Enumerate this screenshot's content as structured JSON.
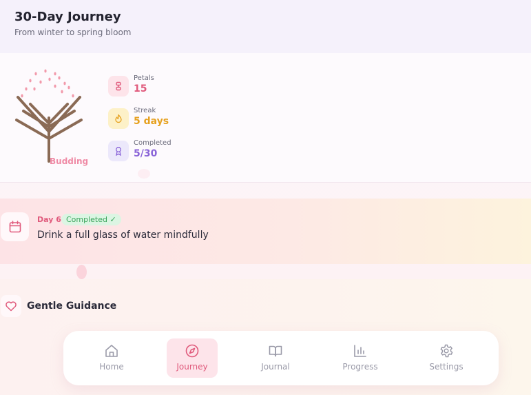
{
  "header": {
    "title": "30-Day Journey",
    "subtitle": "From winter to spring bloom"
  },
  "tree": {
    "stage": "Budding"
  },
  "stats": [
    {
      "label": "Petals",
      "value": "15",
      "icon": "flower-icon"
    },
    {
      "label": "Streak",
      "value": "5 days",
      "icon": "flame-icon"
    },
    {
      "label": "Completed",
      "value": "5/30",
      "icon": "award-icon"
    }
  ],
  "today": {
    "day": "Day 6",
    "status": "Completed ✓",
    "task": "Drink a full glass of water mindfully",
    "icon": "calendar-icon"
  },
  "guidance": {
    "title": "Gentle Guidance",
    "icon": "heart-icon"
  },
  "nav": {
    "items": [
      {
        "label": "Home",
        "icon": "home-icon"
      },
      {
        "label": "Journey",
        "icon": "compass-icon",
        "active": true
      },
      {
        "label": "Journal",
        "icon": "book-icon"
      },
      {
        "label": "Progress",
        "icon": "chart-icon"
      },
      {
        "label": "Settings",
        "icon": "gear-icon"
      }
    ]
  },
  "colors": {
    "accent": "#e05a7c",
    "streak": "#e6a11f",
    "completed": "#8a64d8",
    "badge": "#39a45b"
  }
}
